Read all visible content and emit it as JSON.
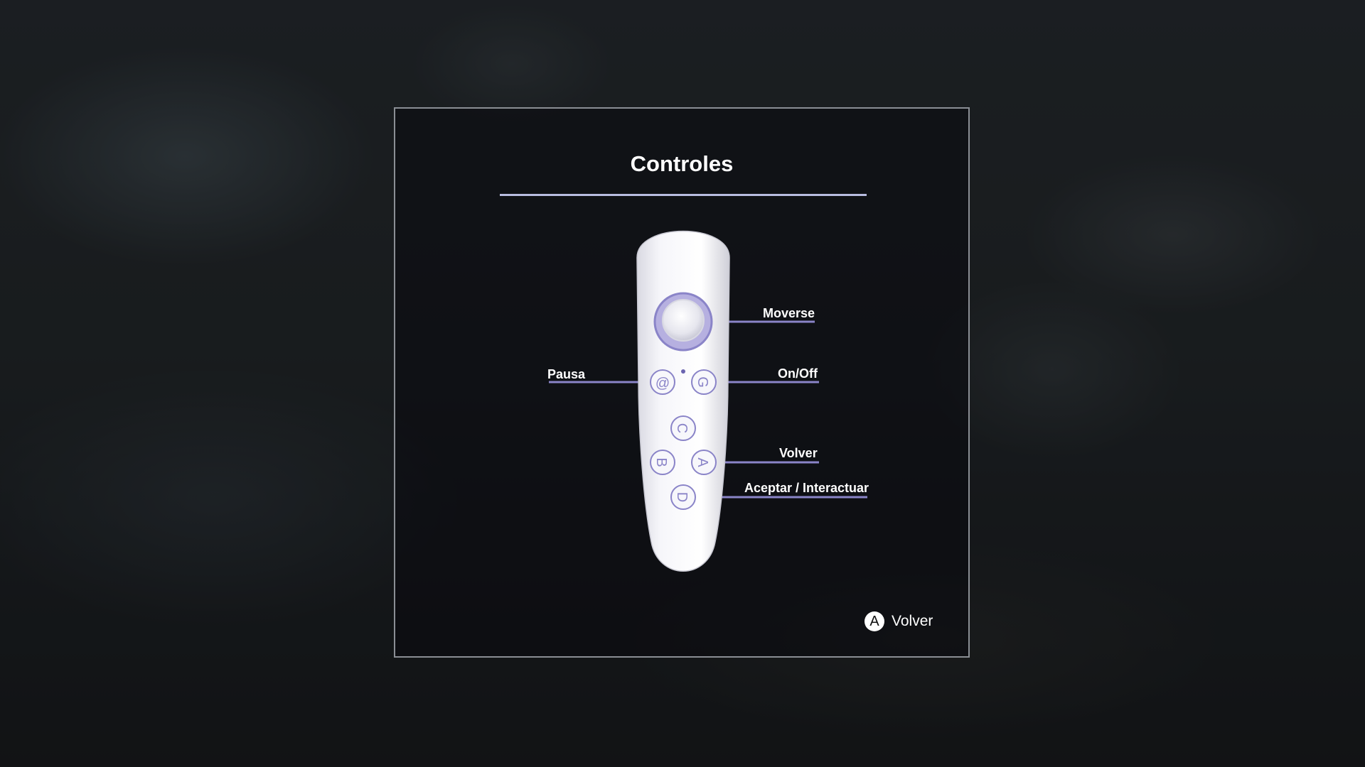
{
  "dialog": {
    "title": "Controles"
  },
  "remote": {
    "buttons": [
      {
        "id": "joystick",
        "glyph": ""
      },
      {
        "id": "pause",
        "glyph": "@"
      },
      {
        "id": "power",
        "glyph": "G"
      },
      {
        "id": "c",
        "glyph": "C"
      },
      {
        "id": "b",
        "glyph": "B"
      },
      {
        "id": "a",
        "glyph": "A"
      },
      {
        "id": "d",
        "glyph": "D"
      }
    ],
    "accent_color": "#8a84c8",
    "body_color": "#f2f2f6"
  },
  "labels": {
    "moverse": "Moverse",
    "pausa": "Pausa",
    "onoff": "On/Off",
    "volver": "Volver",
    "aceptar": "Aceptar / Interactuar"
  },
  "footer": {
    "back_icon": "A",
    "back_label": "Volver"
  }
}
